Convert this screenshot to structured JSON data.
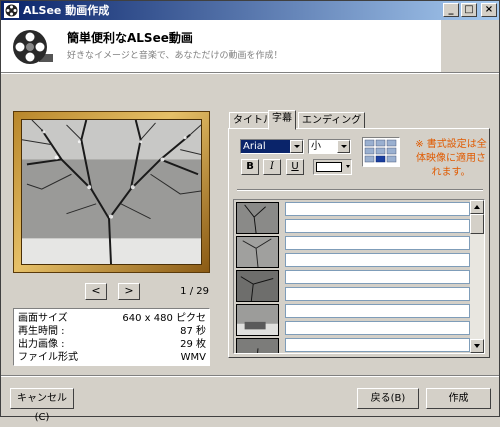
{
  "window": {
    "title": "ALSee 動画作成"
  },
  "title_buttons": {
    "minimize": "_",
    "maximize": "□",
    "close": "×"
  },
  "header": {
    "title": "簡単便利なALSee動画",
    "subtitle": "好きなイメージと音楽で、あなただけの動画を作成！"
  },
  "preview": {
    "page_indicator": "1 / 29",
    "prev_label": "<",
    "next_label": ">"
  },
  "info": {
    "rows": [
      {
        "label": "画面サイズ",
        "value": "640 x 480 ピクセ"
      },
      {
        "label": "再生時間 :",
        "value": "87 秒"
      },
      {
        "label": "出力画像  :",
        "value": "29 枚"
      },
      {
        "label": "ファイル形式",
        "value": "WMV"
      }
    ]
  },
  "tabs": [
    {
      "label": "タイトル"
    },
    {
      "label": "字幕"
    },
    {
      "label": "エンディング"
    }
  ],
  "active_tab": "字幕",
  "format": {
    "font": "Arial",
    "size": "小",
    "bold": "B",
    "italic": "I",
    "underline": "U"
  },
  "notice": "※ 書式設定は全体映像に適用されます。",
  "subtitle_rows": [
    {
      "text": ""
    },
    {
      "text": ""
    },
    {
      "text": ""
    },
    {
      "text": ""
    },
    {
      "text": ""
    },
    {
      "text": ""
    },
    {
      "text": ""
    },
    {
      "text": ""
    },
    {
      "text": ""
    },
    {
      "text": ""
    }
  ],
  "footer": {
    "cancel": "キャンセル(C)",
    "back": "戻る(B)",
    "create": "作成"
  },
  "colors": {
    "accent": "#0a246a",
    "notice": "#e05a00",
    "frame": "#c89a3a"
  }
}
